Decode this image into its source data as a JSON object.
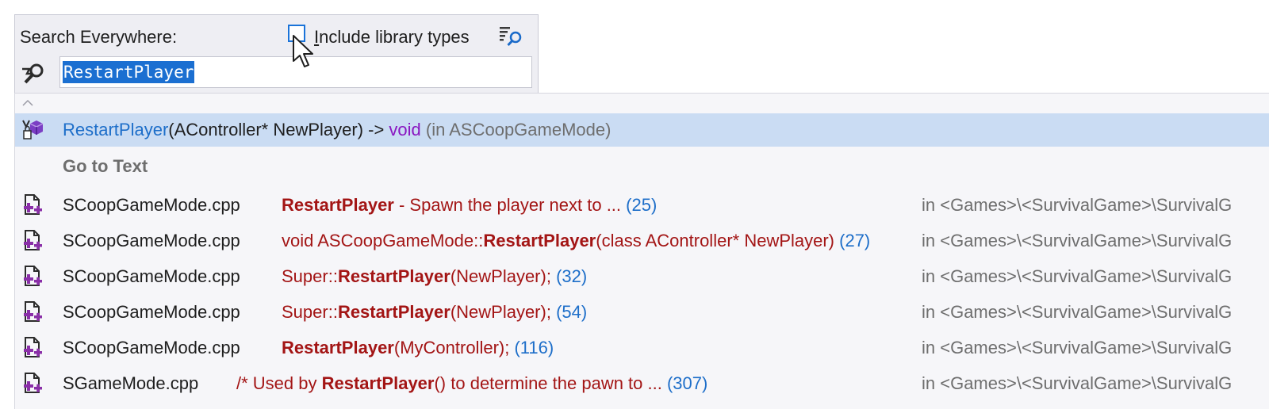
{
  "search": {
    "title": "Search Everywhere:",
    "include_library_label_mnemonic": "I",
    "include_library_label_rest": "nclude library types",
    "include_library_checked": false,
    "query": "RestartPlayer"
  },
  "symbol_result": {
    "name": "RestartPlayer",
    "signature": "(AController* NewPlayer) -> ",
    "return_type": "void",
    "container": " (in ASCoopGameMode)",
    "icon": "method-icon"
  },
  "text_section": {
    "title": "Go to Text",
    "icon": "cpp-file-icon",
    "rows": [
      {
        "file": "SCoopGameMode.cpp",
        "pre": "",
        "match": "RestartPlayer",
        "post": " - Spawn the player next to ...",
        "line": " (25)",
        "location": "in <Games>\\<SurvivalGame>\\SurvivalG"
      },
      {
        "file": "SCoopGameMode.cpp",
        "pre": "void ASCoopGameMode::",
        "match": "RestartPlayer",
        "post": "(class AController* NewPlayer)",
        "line": " (27)",
        "location": "in <Games>\\<SurvivalGame>\\SurvivalG"
      },
      {
        "file": "SCoopGameMode.cpp",
        "pre": "Super::",
        "match": "RestartPlayer",
        "post": "(NewPlayer);",
        "line": " (32)",
        "location": "in <Games>\\<SurvivalGame>\\SurvivalG"
      },
      {
        "file": "SCoopGameMode.cpp",
        "pre": "Super::",
        "match": "RestartPlayer",
        "post": "(NewPlayer);",
        "line": " (54)",
        "location": "in <Games>\\<SurvivalGame>\\SurvivalG"
      },
      {
        "file": "SCoopGameMode.cpp",
        "pre": "",
        "match": "RestartPlayer",
        "post": "(MyController);",
        "line": " (116)",
        "location": "in <Games>\\<SurvivalGame>\\SurvivalG"
      },
      {
        "file": "SGameMode.cpp",
        "pre": "/* Used by ",
        "match": "RestartPlayer",
        "post": "() to determine the pawn to ...",
        "line": " (307)",
        "location": "in <Games>\\<SurvivalGame>\\SurvivalG"
      }
    ]
  },
  "colors": {
    "selection": "#cadcf3",
    "method_name": "#1d6ec9",
    "keyword": "#8a17c1",
    "text_match": "#a31515",
    "checkbox_border": "#1a73d9"
  }
}
